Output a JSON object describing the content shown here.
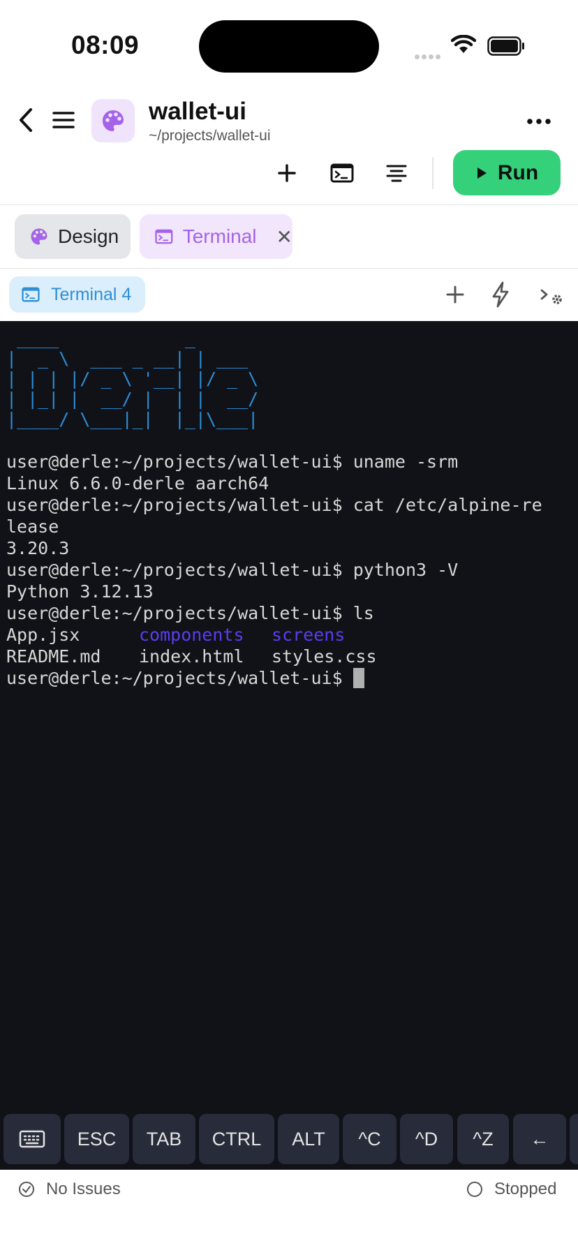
{
  "status_bar": {
    "time": "08:09"
  },
  "header": {
    "project_name": "wallet-ui",
    "project_path": "~/projects/wallet-ui",
    "icons": [
      "back-icon",
      "hamburger-icon",
      "palette-icon",
      "more-icon"
    ]
  },
  "toolbar": {
    "run_label": "Run",
    "accent": "#34d17a"
  },
  "tabs": [
    {
      "label": "Design",
      "icon": "palette-icon"
    },
    {
      "label": "Terminal",
      "icon": "terminal-icon",
      "active": true,
      "close": "✕"
    }
  ],
  "subtabs": {
    "active_label": "Terminal 4"
  },
  "terminal": {
    "banner": " ____            _\n|  _ \\  ___ _ __| | ___\n| | | |/ _ \\ '__| |/ _ \\\n| |_| |  __/ |  | |  __/\n|____/ \\___|_|  |_|\\___|",
    "prompt": "user@derle:~/projects/wallet-ui$",
    "lines": {
      "cmd1": "uname -srm",
      "out1": "Linux 6.6.0-derle aarch64",
      "cmd2": "cat /etc/alpine-re",
      "cmd2_wrap": "lease",
      "out2": "3.20.3",
      "cmd3": "python3 -V",
      "out3": "Python 3.12.13",
      "cmd4": "ls",
      "ls_row1": {
        "a": "App.jsx",
        "b": "components",
        "c": "screens"
      },
      "ls_row2": {
        "a": "README.md",
        "b": "index.html",
        "c": "styles.css"
      }
    },
    "dir_color": "#5b3cf2",
    "banner_color": "#2b8ed8"
  },
  "keybar": {
    "keys": [
      "ESC",
      "TAB",
      "CTRL",
      "ALT",
      "^C",
      "^D",
      "^Z",
      "←"
    ]
  },
  "footer": {
    "issues": "No Issues",
    "status": "Stopped"
  }
}
